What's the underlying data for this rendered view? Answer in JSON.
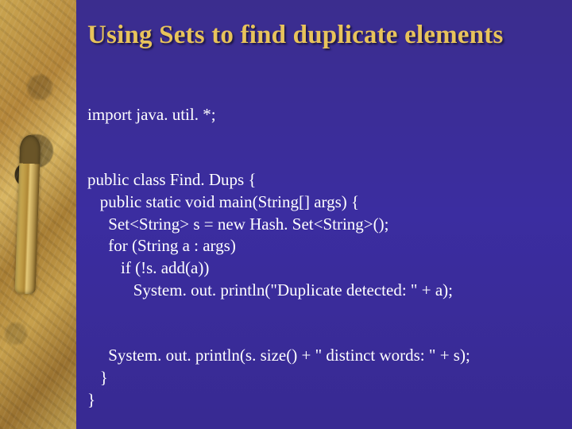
{
  "title": "Using Sets to find duplicate elements",
  "code": {
    "l1": "import java. util. *;",
    "l2": "public class Find. Dups {",
    "l3": "   public static void main(String[] args) {",
    "l4": "     Set<String> s = new Hash. Set<String>();",
    "l5": "     for (String a : args)",
    "l6": "        if (!s. add(a))",
    "l7": "           System. out. println(\"Duplicate detected: \" + a);",
    "l8": "     System. out. println(s. size() + \" distinct words: \" + s);",
    "l9": "   }",
    "l10": "}"
  }
}
